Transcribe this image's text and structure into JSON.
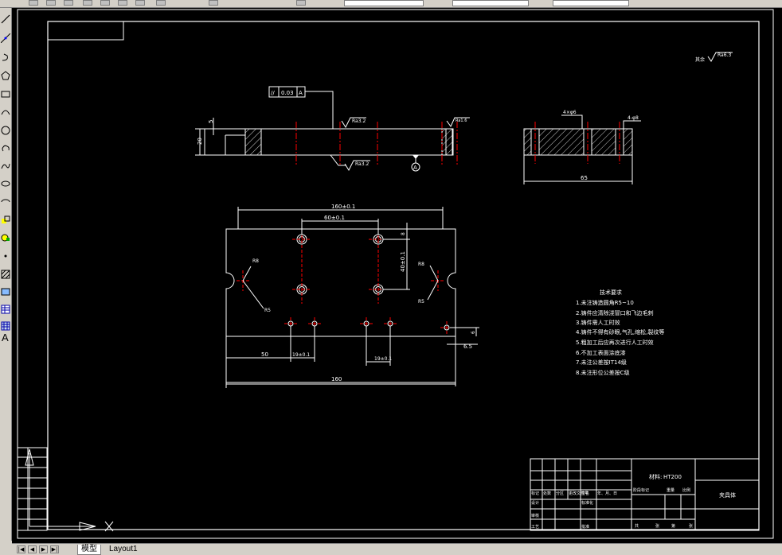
{
  "colors": {
    "background": "#000000",
    "linework": "#ffffff",
    "centerline": "#ff0000",
    "hatch": "#ffffff"
  },
  "toolbar": {
    "icons": [
      "new-file-icon",
      "open-icon",
      "save-icon",
      "print-icon",
      "undo-icon",
      "redo-icon",
      "pan-icon",
      "zoom-icon",
      "properties-icon",
      "layer-icon"
    ]
  },
  "left_toolbar": {
    "icons": [
      "line-icon",
      "construction-line-icon",
      "polyline-icon",
      "polygon-icon",
      "rectangle-icon",
      "arc-icon",
      "circle-icon",
      "revision-cloud-icon",
      "spline-icon",
      "ellipse-icon",
      "ellipse-arc-icon",
      "insert-block-icon",
      "make-block-icon",
      "point-icon",
      "hatch-icon",
      "region-icon",
      "table-icon",
      "multiline-text-icon"
    ],
    "text_tool": "A"
  },
  "drawing": {
    "dims": {
      "top_view": [
        "5",
        "20"
      ],
      "side_view": [
        "4×φ6",
        "4-φ8",
        "65"
      ],
      "plan": [
        "160±0.1",
        "60±0.1",
        "40±0.1",
        "8",
        "R8",
        "R5",
        "R8",
        "R5",
        "50",
        "19±0.1",
        "19±0.1",
        "6",
        "6.5",
        "160"
      ]
    },
    "roughness": {
      "top": "Ra3.2",
      "bottom": "Ra3.2",
      "rest_label": "其余",
      "rest": "Ra6.3",
      "side": "Ra1.6"
    },
    "tolerance": {
      "symbol": "//",
      "value": "0.03",
      "datum": "A"
    },
    "datum_label": "A",
    "tech_title": "技术要求",
    "tech": [
      "1.未注铸造圆角R5~10",
      "2.铸件应清除浇冒口和飞边毛刺",
      "3.铸件需人工时效",
      "4.铸件不得有砂眼,气孔,缩松,裂纹等",
      "5.粗加工后应再次进行人工时效",
      "6.不加工表面涂底漆",
      "7.未注公差按IT14级",
      "8.未注形位公差按C级"
    ],
    "title_block": {
      "material_label": "材料:",
      "material": "HT200",
      "part_name": "夹具体",
      "labels": [
        "标记",
        "处数",
        "分区",
        "更改文件号",
        "签名",
        "年、月、日",
        "设计",
        "标准化",
        "审核",
        "工艺",
        "批准",
        "阶段标记",
        "重量",
        "比例",
        "共",
        "张",
        "第",
        "张"
      ]
    }
  },
  "tabs": {
    "model": "模型",
    "layout1": "Layout1"
  },
  "nav": {
    "first": "|◀",
    "prev": "◀",
    "next": "▶",
    "last": "▶|"
  }
}
